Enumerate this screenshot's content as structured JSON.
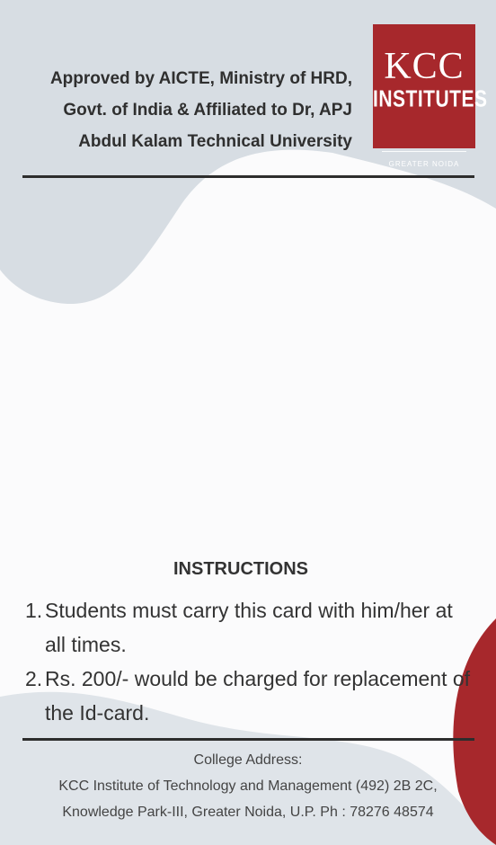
{
  "header": {
    "approval_lines": [
      "Approved by AICTE, Ministry of HRD,",
      "Govt. of India & Affiliated to Dr, APJ",
      "Abdul Kalam Technical University"
    ]
  },
  "logo": {
    "name": "KCC",
    "tagline": "INSTITUTES",
    "location": "GREATER NOIDA",
    "color": "#a7282c"
  },
  "instructions": {
    "title": "INSTRUCTIONS",
    "items": [
      {
        "number": "1.",
        "text": "Students must carry this card with him/her at all times."
      },
      {
        "number": "2.",
        "text": "Rs. 200/- would be charged for replacement of the Id-card."
      }
    ]
  },
  "footer": {
    "label": "College Address:",
    "line1": "KCC Institute of Technology and Management (492) 2B 2C,",
    "line2": "Knowledge Park-III, Greater Noida, U.P. Ph : 78276 48574"
  },
  "colors": {
    "background": "#fbfbfc",
    "wave": "#d7dde3",
    "accent": "#a7282c",
    "rule": "#2d2d2d"
  }
}
